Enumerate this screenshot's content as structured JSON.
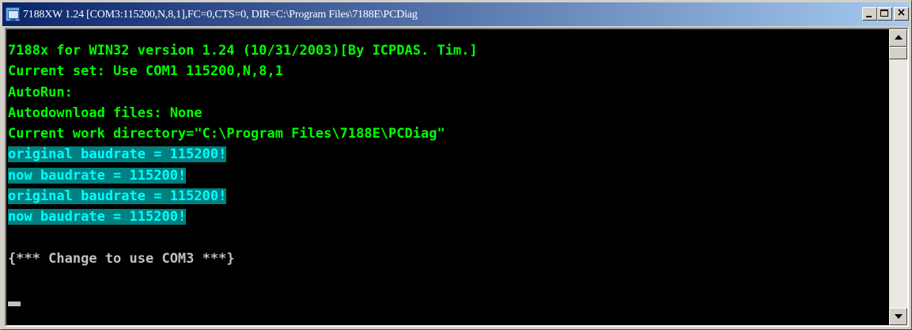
{
  "window": {
    "title": "7188XW 1.24 [COM3:115200,N,8,1],FC=0,CTS=0, DIR=C:\\Program Files\\7188E\\PCDiag",
    "icon": "app-icon",
    "controls": {
      "minimize_icon": "minimize-icon",
      "maximize_icon": "maximize-icon",
      "close_icon": "close-icon",
      "close_glyph": "×"
    }
  },
  "colors": {
    "titlebar_start": "#0a246a",
    "titlebar_end": "#a6caf0",
    "console_bg": "#000000",
    "console_green": "#00ff00",
    "highlight_bg": "#008080",
    "highlight_fg": "#00ffff",
    "console_white": "#c0c0c0"
  },
  "console": {
    "lines": [
      {
        "text": "7188x for WIN32 version 1.24 (10/31/2003)[By ICPDAS. Tim.]",
        "style": "green"
      },
      {
        "text": "Current set: Use COM1 115200,N,8,1",
        "style": "green"
      },
      {
        "text": "AutoRun:",
        "style": "green"
      },
      {
        "text": "Autodownload files: None",
        "style": "green"
      },
      {
        "text": "Current work directory=\"C:\\Program Files\\7188E\\PCDiag\"",
        "style": "green"
      },
      {
        "text": "original baudrate = 115200!",
        "style": "highlight"
      },
      {
        "text": "now baudrate = 115200!",
        "style": "highlight"
      },
      {
        "text": "original baudrate = 115200!",
        "style": "highlight"
      },
      {
        "text": "now baudrate = 115200!",
        "style": "highlight"
      },
      {
        "text": "",
        "style": "white"
      },
      {
        "text": "{*** Change to use COM3 ***}",
        "style": "white"
      }
    ]
  },
  "scrollbar": {
    "up_icon": "scroll-up-arrow-icon",
    "down_icon": "scroll-down-arrow-icon"
  }
}
